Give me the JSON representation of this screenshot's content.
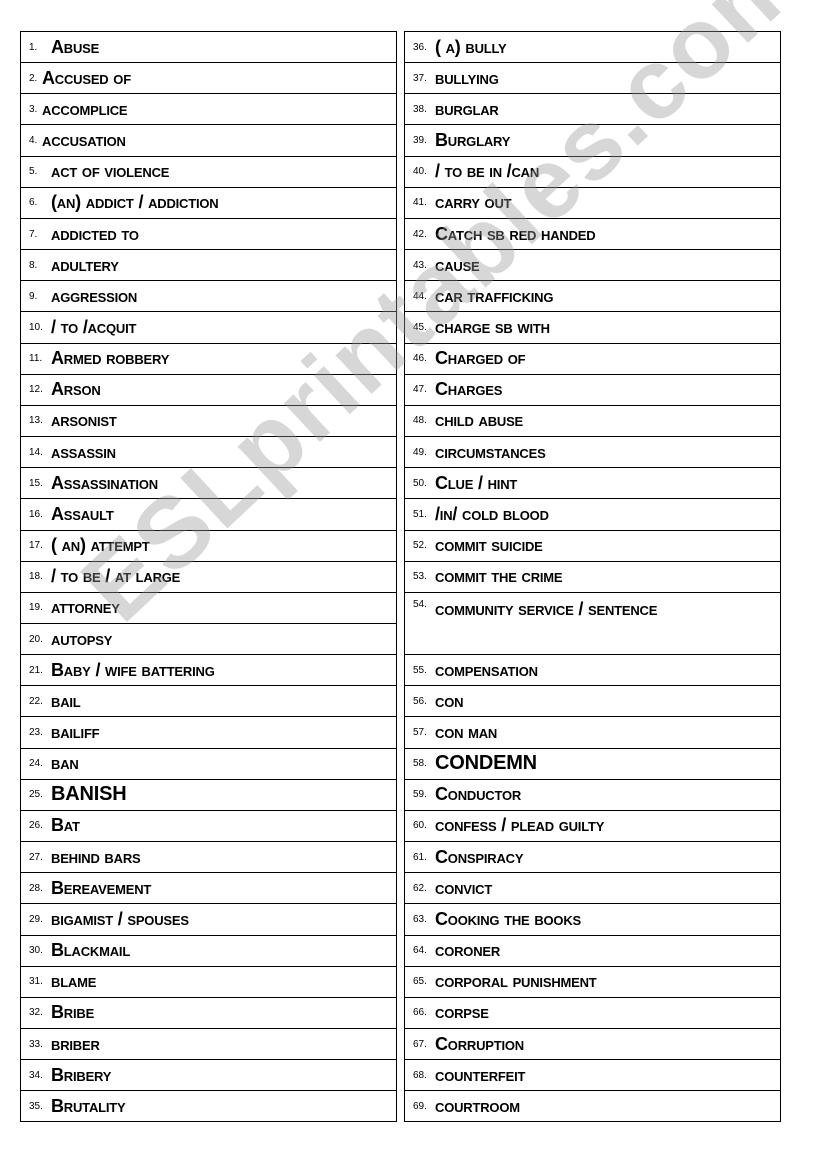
{
  "watermark": "ESLprintables.com",
  "left": [
    {
      "n": "1.",
      "t": "Abuse"
    },
    {
      "n": "2.",
      "t": "Accused of"
    },
    {
      "n": "3.",
      "t": "accomplice"
    },
    {
      "n": "4.",
      "t": "accusation"
    },
    {
      "n": "5.",
      "t": "act of violence"
    },
    {
      "n": "6.",
      "t": "(an) addict / addiction"
    },
    {
      "n": "7.",
      "t": "addicted to"
    },
    {
      "n": "8.",
      "t": "adultery"
    },
    {
      "n": "9.",
      "t": "aggression"
    },
    {
      "n": "10.",
      "t": "/ to /acquit"
    },
    {
      "n": "11.",
      "t": "Armed robbery"
    },
    {
      "n": "12.",
      "t": "Arson"
    },
    {
      "n": "13.",
      "t": "arsonist"
    },
    {
      "n": "14.",
      "t": "assassin"
    },
    {
      "n": "15.",
      "t": "Assassination"
    },
    {
      "n": "16.",
      "t": "Assault"
    },
    {
      "n": "17.",
      "t": "( an) attempt"
    },
    {
      "n": "18.",
      "t": "/ to be / at large"
    },
    {
      "n": "19.",
      "t": "attorney"
    },
    {
      "n": "20.",
      "t": "autopsy"
    },
    {
      "n": "21.",
      "t": "Baby / wife battering"
    },
    {
      "n": "22.",
      "t": "bail"
    },
    {
      "n": "23.",
      "t": "bailiff"
    },
    {
      "n": "24.",
      "t": "ban"
    },
    {
      "n": "25.",
      "t": "BANISH"
    },
    {
      "n": "26.",
      "t": "Bat"
    },
    {
      "n": "27.",
      "t": "behind bars"
    },
    {
      "n": "28.",
      "t": "Bereavement"
    },
    {
      "n": "29.",
      "t": "bigamist / spouses"
    },
    {
      "n": "30.",
      "t": "Blackmail"
    },
    {
      "n": "31.",
      "t": "blame"
    },
    {
      "n": "32.",
      "t": "Bribe"
    },
    {
      "n": "33.",
      "t": "briber"
    },
    {
      "n": "34.",
      "t": "Bribery"
    },
    {
      "n": "35.",
      "t": "Brutality"
    }
  ],
  "right": [
    {
      "n": "36.",
      "t": "( a) bully"
    },
    {
      "n": "37.",
      "t": "bullying"
    },
    {
      "n": "38.",
      "t": "burglar"
    },
    {
      "n": "39.",
      "t": "Burglary"
    },
    {
      "n": "40.",
      "t": "/ to be in  /can"
    },
    {
      "n": "41.",
      "t": "carry out"
    },
    {
      "n": "42.",
      "t": "Catch sb red handed"
    },
    {
      "n": "43.",
      "t": "cause"
    },
    {
      "n": "44.",
      "t": "car trafficking"
    },
    {
      "n": "45.",
      "t": "charge sb with"
    },
    {
      "n": "46.",
      "t": "Charged of"
    },
    {
      "n": "47.",
      "t": "Charges"
    },
    {
      "n": "48.",
      "t": "child abuse"
    },
    {
      "n": "49.",
      "t": "circumstances"
    },
    {
      "n": "50.",
      "t": "Clue / hint"
    },
    {
      "n": "51.",
      "t": "/in/  cold blood"
    },
    {
      "n": "52.",
      "t": "commit suicide"
    },
    {
      "n": "53.",
      "t": "commit the crime"
    },
    {
      "n": "54.",
      "t": "community service / sentence"
    },
    {
      "n": "55.",
      "t": "compensation"
    },
    {
      "n": "56.",
      "t": "con"
    },
    {
      "n": "57.",
      "t": "con man"
    },
    {
      "n": "58.",
      "t": "CONDEMN"
    },
    {
      "n": "59.",
      "t": "Conductor"
    },
    {
      "n": "60.",
      "t": "confess / plead guilty"
    },
    {
      "n": "61.",
      "t": "Conspiracy"
    },
    {
      "n": "62.",
      "t": "convict"
    },
    {
      "n": "63.",
      "t": "Cooking the books"
    },
    {
      "n": "64.",
      "t": "coroner"
    },
    {
      "n": "65.",
      "t": "corporal punishment"
    },
    {
      "n": "66.",
      "t": "corpse"
    },
    {
      "n": "67.",
      "t": "Corruption"
    },
    {
      "n": "68.",
      "t": "counterfeit"
    },
    {
      "n": "69.",
      "t": "courtroom"
    }
  ]
}
